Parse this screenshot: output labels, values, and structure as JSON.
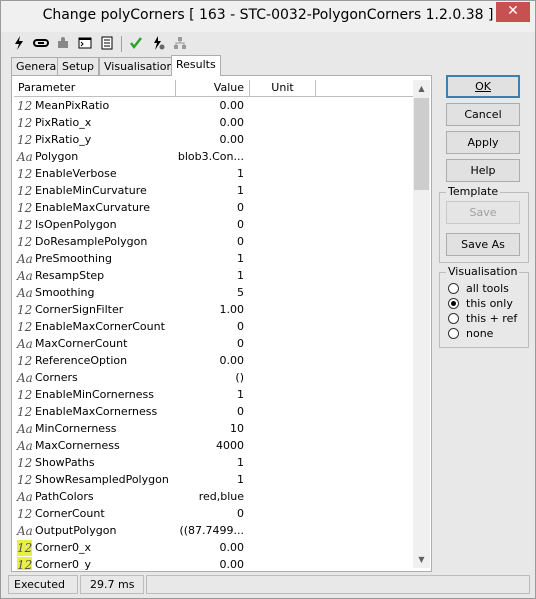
{
  "window": {
    "title": "Change polyCorners [ 163 - STC-0032-PolygonCorners 1.2.0.38 ]",
    "close_glyph": "✕"
  },
  "toolbar": {
    "icons": [
      "lightning-icon",
      "link-icon",
      "puzzle-icon",
      "console-icon",
      "document-icon",
      "checkmark-icon",
      "lightning-settings-icon",
      "network-icon"
    ]
  },
  "tabs": [
    "General",
    "Setup",
    "Visualisation",
    "Results"
  ],
  "active_tab": "Results",
  "grid": {
    "columns": [
      "Parameter",
      "Value",
      "Unit"
    ],
    "rows": [
      {
        "type": "12",
        "name": "MeanPixRatio",
        "value": "0.00"
      },
      {
        "type": "12",
        "name": "PixRatio_x",
        "value": "0.00"
      },
      {
        "type": "12",
        "name": "PixRatio_y",
        "value": "0.00"
      },
      {
        "type": "Aa",
        "name": "Polygon",
        "value": "blob3.Con..."
      },
      {
        "type": "12",
        "name": "EnableVerbose",
        "value": "1"
      },
      {
        "type": "12",
        "name": "EnableMinCurvature",
        "value": "1"
      },
      {
        "type": "12",
        "name": "EnableMaxCurvature",
        "value": "0"
      },
      {
        "type": "12",
        "name": "IsOpenPolygon",
        "value": "0"
      },
      {
        "type": "12",
        "name": "DoResamplePolygon",
        "value": "0"
      },
      {
        "type": "Aa",
        "name": "PreSmoothing",
        "value": "1"
      },
      {
        "type": "Aa",
        "name": "ResampStep",
        "value": "1"
      },
      {
        "type": "Aa",
        "name": "Smoothing",
        "value": "5"
      },
      {
        "type": "12",
        "name": "CornerSignFilter",
        "value": "1.00"
      },
      {
        "type": "12",
        "name": "EnableMaxCornerCount",
        "value": "0"
      },
      {
        "type": "Aa",
        "name": "MaxCornerCount",
        "value": "0"
      },
      {
        "type": "12",
        "name": "ReferenceOption",
        "value": "0.00"
      },
      {
        "type": "Aa",
        "name": "Corners",
        "value": "()"
      },
      {
        "type": "12",
        "name": "EnableMinCornerness",
        "value": "1"
      },
      {
        "type": "12",
        "name": "EnableMaxCornerness",
        "value": "0"
      },
      {
        "type": "Aa",
        "name": "MinCornerness",
        "value": "10"
      },
      {
        "type": "Aa",
        "name": "MaxCornerness",
        "value": "4000"
      },
      {
        "type": "12",
        "name": "ShowPaths",
        "value": "1"
      },
      {
        "type": "12",
        "name": "ShowResampledPolygon",
        "value": "1"
      },
      {
        "type": "Aa",
        "name": "PathColors",
        "value": "red,blue"
      },
      {
        "type": "12",
        "name": "CornerCount",
        "value": "0"
      },
      {
        "type": "Aa",
        "name": "OutputPolygon",
        "value": "((87.7499..."
      },
      {
        "type": "12",
        "name": "Corner0_x",
        "value": "0.00",
        "highlight": true
      },
      {
        "type": "12",
        "name": "Corner0_y",
        "value": "0.00",
        "highlight": true
      }
    ]
  },
  "buttons": {
    "ok": "OK",
    "cancel": "Cancel",
    "apply": "Apply",
    "help": "Help",
    "save": "Save",
    "save_as": "Save As"
  },
  "template_group": {
    "title": "Template"
  },
  "visualisation_group": {
    "title": "Visualisation",
    "options": [
      "all tools",
      "this only",
      "this + ref",
      "none"
    ],
    "selected": "this only"
  },
  "status": {
    "state": "Executed",
    "time": "29.7 ms"
  },
  "colors": {
    "highlight_icon": "#e8f047",
    "default_button_border": "#3c7fb1",
    "close_button": "#c75050"
  }
}
